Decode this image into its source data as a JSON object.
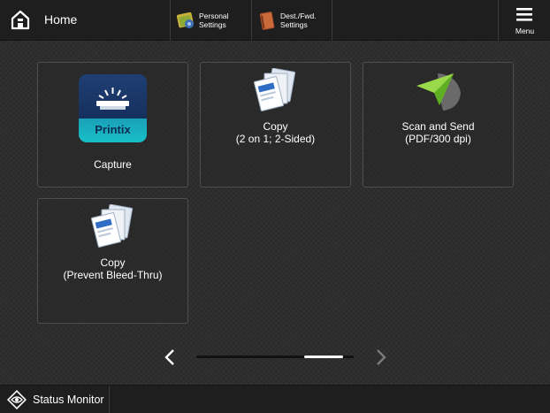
{
  "header": {
    "home_label": "Home",
    "personal_settings": {
      "line1": "Personal",
      "line2": "Settings"
    },
    "dest_settings": {
      "line1": "Dest./Fwd.",
      "line2": "Settings"
    },
    "menu_label": "Menu"
  },
  "tiles": [
    {
      "icon": "printix-logo-icon",
      "logo_text": "Printix",
      "line1": "Capture",
      "line2": ""
    },
    {
      "icon": "copy-icon",
      "line1": "Copy",
      "line2": "(2 on 1; 2-Sided)"
    },
    {
      "icon": "scan-send-icon",
      "line1": "Scan and Send",
      "line2": "(PDF/300 dpi)"
    },
    {
      "icon": "copy-icon",
      "line1": "Copy",
      "line2": "(Prevent Bleed-Thru)"
    }
  ],
  "pager": {
    "current_page": 2,
    "total_pages": 2,
    "prev_icon": "chevron-left-icon",
    "next_icon": "chevron-right-icon"
  },
  "footer": {
    "status_monitor_label": "Status Monitor"
  },
  "colors": {
    "bar_background": "#1e1e1e",
    "printix_dark": "#16305d",
    "printix_teal": "#18c0c8",
    "scan_green": "#7ec832"
  }
}
